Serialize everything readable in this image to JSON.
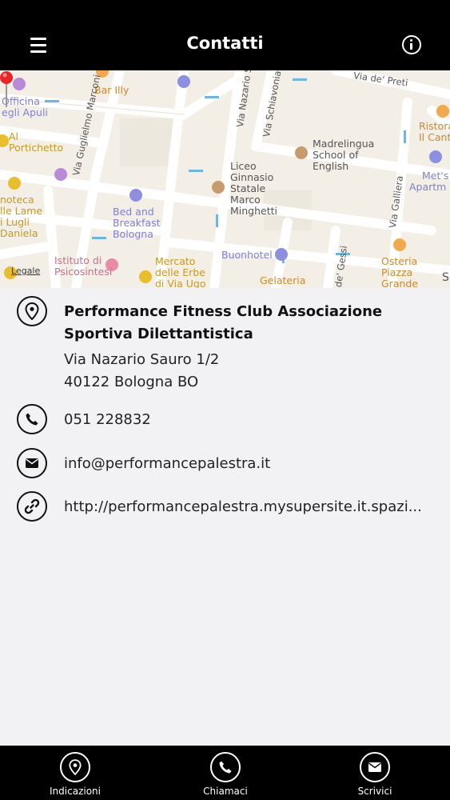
{
  "header": {
    "title": "Contatti"
  },
  "map": {
    "labels": {
      "bar_illy": "Bar Illy",
      "officina": "Officina",
      "degli_apuli": "egli Apuli",
      "al": "Al",
      "portichetto": "Portichetto",
      "noteca": "noteca",
      "lle_lame": "lle Lame",
      "di_lugli": "i Lugli",
      "daniela": "Daniela",
      "via_guglielmo_marconi": "Via Guglielmo Marconi",
      "via_nazario_sauro": "Via Nazario S",
      "via_schiavonia": "Via Schiavonia",
      "via_de_preti": "Via de' Preti",
      "madrelingua": "Madrelingua",
      "school_of": "School of",
      "english": "English",
      "ristora": "Ristora",
      "il_cantu": "Il Cantu",
      "mets": "Met's",
      "apartm": "Apartm",
      "liceo": "Liceo",
      "ginnasio": "Ginnasio",
      "statale": "Statale",
      "marco": "Marco",
      "minghetti": "Minghetti",
      "bed_and": "Bed and",
      "breakfast": "Breakfast",
      "bologna": "Bologna",
      "via_galliera": "Via Galliera",
      "istituto_di": "Istituto di",
      "psicosintesi": "Psicosintesi",
      "mercato": "Mercato",
      "delle_erbe": "delle Erbe",
      "di_via_ugo": "di Via Ugo",
      "buonhotel": "Buonhotel",
      "via_de_gessi": "de' Gessi",
      "gelateria": "Gelateria",
      "osteria": "Osteria",
      "piazza": "Piazza",
      "grande": "Grande",
      "s": "S"
    },
    "legal": "Legale"
  },
  "contact": {
    "name": "Performance Fitness Club Associazione Sportiva Dilettantistica",
    "address_line1": "Via Nazario Sauro 1/2",
    "address_line2": "40122 Bologna BO",
    "phone": "051 228832",
    "email": "info@performancepalestra.it",
    "website": "http://performancepalestra.mysupersite.it.spazi..."
  },
  "tabbar": {
    "directions": "Indicazioni",
    "call": "Chiamaci",
    "write": "Scrivici"
  },
  "colors": {
    "header_bg": "#000000",
    "background": "#f2f2f4",
    "map_bg": "#f3efe6",
    "pin": "#e8262a"
  }
}
